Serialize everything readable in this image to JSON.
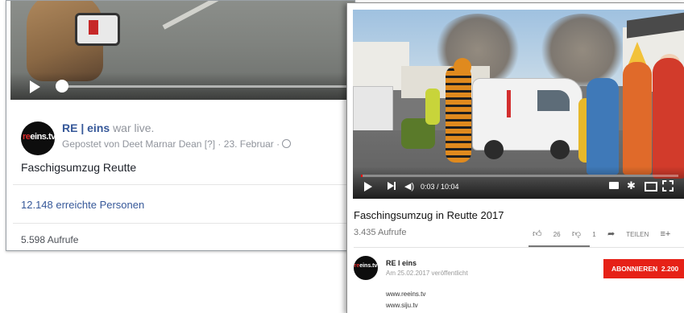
{
  "facebook": {
    "page_name": "RE | eins",
    "live_suffix": "war live.",
    "posted_by": "Gepostet von Deet Marnar Dean [?] · 23. Februar ·",
    "post_text": "Faschigsumzug Reutte",
    "reach": "12.148 erreichte Personen",
    "views": "5.598 Aufrufe",
    "avatar_text": {
      "a": "re",
      "b": "eins.tv"
    },
    "playback_fraction": 0.03
  },
  "youtube": {
    "video_title": "Faschingsumzug in Reutte 2017",
    "views": "3.435 Aufrufe",
    "time": "0:03 / 10:04",
    "likes": "26",
    "dislikes": "1",
    "share_label": "TEILEN",
    "more_label": "···",
    "channel_name": "RE l eins",
    "published": "Am 25.02.2017 veröffentlicht",
    "subscribe_label": "ABONNIEREN",
    "subscriber_count": "2.200",
    "links": [
      "www.reeins.tv",
      "www.siju.tv"
    ],
    "avatar_text": {
      "a": "re",
      "b": "eins.tv"
    },
    "playback_fraction": 0.005
  },
  "colors": {
    "fb_link": "#365899",
    "yt_red": "#e62117",
    "yt_progress": "#ff0000"
  },
  "icons": [
    "play-icon",
    "next-icon",
    "volume-icon",
    "captions-icon",
    "settings-icon",
    "theater-icon",
    "fullscreen-icon",
    "thumbs-up-icon",
    "thumbs-down-icon",
    "share-icon",
    "add-to-icon",
    "globe-icon"
  ]
}
